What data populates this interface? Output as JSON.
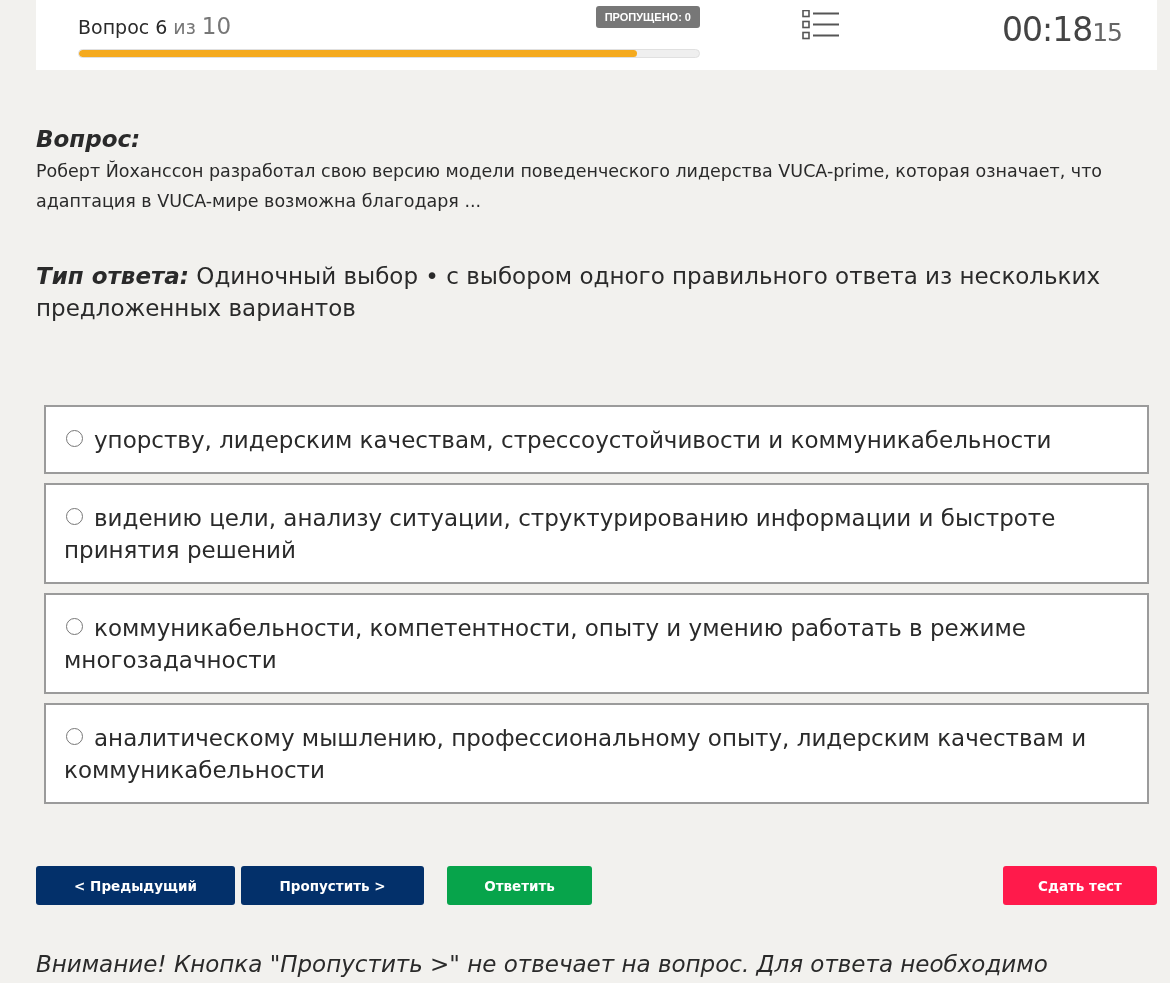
{
  "header": {
    "counter_label": "Вопрос 6",
    "counter_of": "из",
    "counter_total": "10",
    "skipped_badge": "ПРОПУЩЕНО: 0",
    "progress": {
      "level": 0.9
    },
    "timer": {
      "main": "00:18",
      "seconds": "15"
    }
  },
  "question": {
    "heading": "Вопрос:",
    "text": "Роберт Йоханссон разработал свою версию модели поведенческого лидерства VUCA-prime, которая означает, что адаптация в VUCA-мире возможна благодаря ..."
  },
  "answer_type": {
    "label": "Тип ответа:",
    "text": "Одиночный выбор • с выбором одного правильного ответа из нескольких предложенных вариантов"
  },
  "options": [
    {
      "text": "упорству, лидерским качествам, стрессоустойчивости и коммуникабельности",
      "selected": false
    },
    {
      "text": "видению цели, анализу ситуации, структурированию информации и быстроте принятия решений",
      "selected": false
    },
    {
      "text": "коммуникабельности, компетентности, опыту и умению работать в режиме многозадачности",
      "selected": false
    },
    {
      "text": "аналитическому мышлению, профессиональному опыту, лидерским качествам и коммуникабельности",
      "selected": false
    }
  ],
  "buttons": [
    {
      "label": "< Предыдущий",
      "kind": "primary"
    },
    {
      "label": "Пропустить >",
      "kind": "primary"
    },
    {
      "label": "Ответить",
      "kind": "confirm"
    },
    {
      "label": "Сдать тест",
      "kind": "danger"
    }
  ],
  "notice": "Внимание! Кнопка \"Пропустить >\" не отвечает на вопрос. Для ответа необходимо"
}
